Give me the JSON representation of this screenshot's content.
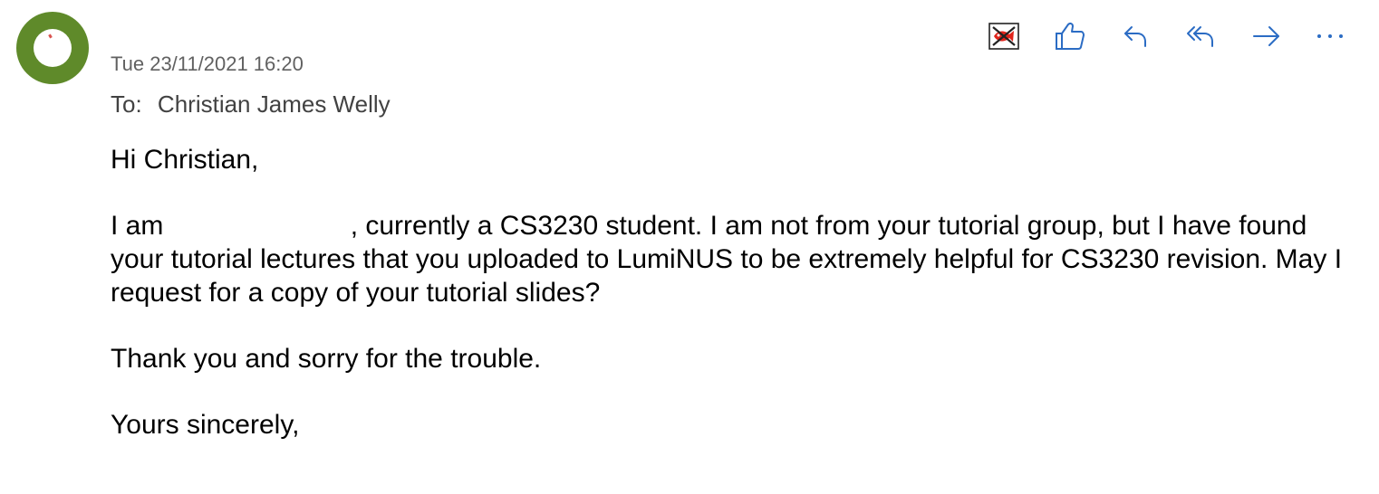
{
  "message": {
    "date": "Tue 23/11/2021 16:20",
    "to_label": "To:",
    "to_name": "Christian James Welly",
    "greeting": "Hi Christian,",
    "para1_start": "I am",
    "para1_rest": ", currently a CS3230 student. I am not from your tutorial group, but I have found your tutorial lectures that you uploaded to LumiNUS to be extremely helpful for CS3230 revision. May I request for a copy of your tutorial slides?",
    "para2": "Thank you and sorry for the trouble.",
    "closing": "Yours sincerely,"
  },
  "toolbar": {
    "icons": [
      "blocked-image-icon",
      "thumbs-up-icon",
      "reply-icon",
      "reply-all-icon",
      "forward-icon",
      "more-icon"
    ]
  },
  "colors": {
    "avatar": "#5f8a2a",
    "accent": "#2b6cc4",
    "meta_text": "#616161"
  }
}
